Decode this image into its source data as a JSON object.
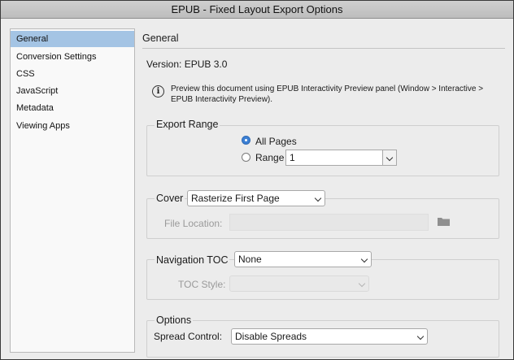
{
  "window": {
    "title": "EPUB - Fixed Layout Export Options"
  },
  "sidebar": {
    "items": [
      {
        "label": "General",
        "selected": true
      },
      {
        "label": "Conversion Settings"
      },
      {
        "label": "CSS"
      },
      {
        "label": "JavaScript"
      },
      {
        "label": "Metadata"
      },
      {
        "label": "Viewing Apps"
      }
    ]
  },
  "main": {
    "section_title": "General",
    "version": "Version: EPUB 3.0",
    "info_icon": "info-icon",
    "info_text": "Preview this document using EPUB Interactivity Preview panel (Window > Interactive > EPUB Interactivity Preview).",
    "export_range": {
      "label": "Export Range",
      "all_pages_label": "All Pages",
      "all_pages_checked": true,
      "range_label": "Range",
      "range_value": "1"
    },
    "cover": {
      "label": "Cover",
      "value": "Rasterize First Page",
      "file_location_label": "File Location:",
      "file_location_value": "",
      "folder_icon": "folder-icon"
    },
    "navigation_toc": {
      "label": "Navigation TOC",
      "value": "None",
      "toc_style_label": "TOC Style:",
      "toc_style_value": ""
    },
    "options": {
      "label": "Options",
      "spread_control_label": "Spread Control:",
      "spread_control_value": "Disable Spreads"
    }
  },
  "colors": {
    "selected_item": "#a4c4e4",
    "radio_checked": "#3b7fd4",
    "window_background": "#ececec"
  }
}
